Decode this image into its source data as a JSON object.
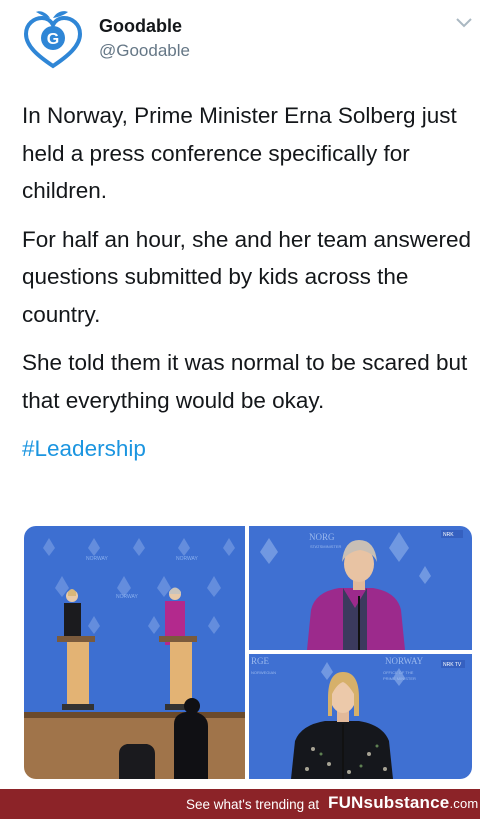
{
  "header": {
    "display_name": "Goodable",
    "handle": "@Goodable",
    "avatar_letter": "G"
  },
  "tweet": {
    "paragraph_1": "In Norway, Prime Minister Erna Solberg just held a press conference specifically for children.",
    "paragraph_2": "For half an hour, she and her team answered questions submitted by kids across the country.",
    "paragraph_3": "She told them it was normal to be scared but that everything would be okay.",
    "hashtag": "#Leadership"
  },
  "media": {
    "photo_1_stage_text": "NORWAY",
    "photo_2_backdrop": "NORG",
    "photo_2_badge": "NRK",
    "photo_3_backdrop_left": "RGE",
    "photo_3_backdrop_right": "NORWAY",
    "photo_3_badge": "NRK TV"
  },
  "footer": {
    "trending_text": "See what's trending at",
    "brand_fun": "FUN",
    "brand_substance": "substance",
    "brand_tld": ".com"
  },
  "colors": {
    "hashtag": "#1b95e0",
    "footer_bg": "#8c2328",
    "backdrop_blue": "#3d6fd1",
    "avatar_blue": "#2f86d6"
  }
}
